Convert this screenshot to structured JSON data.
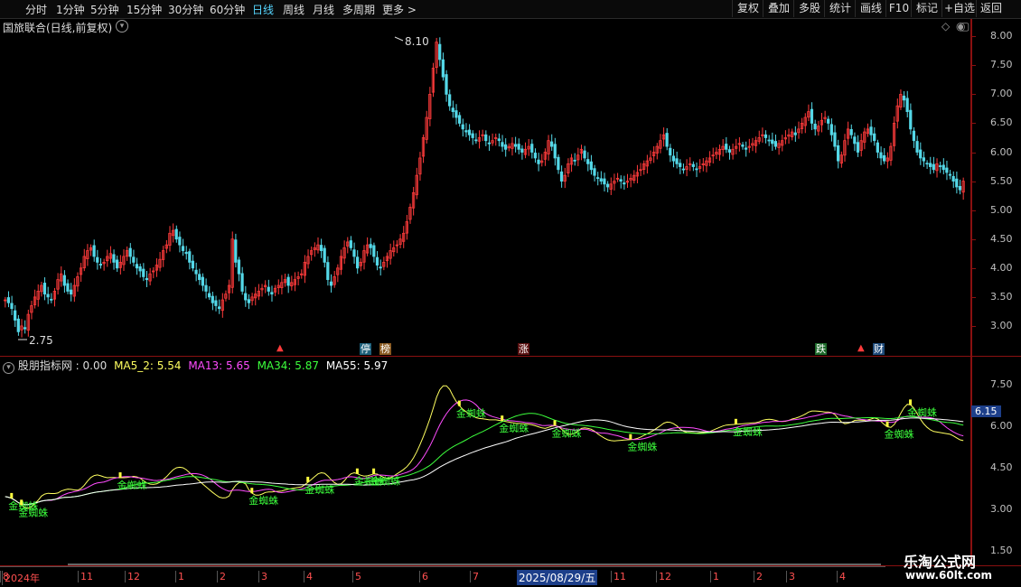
{
  "toolbar": {
    "periods": [
      "分时",
      "1分钟",
      "5分钟",
      "15分钟",
      "30分钟",
      "60分钟",
      "日线",
      "周线",
      "月线",
      "多周期",
      "更多 >"
    ],
    "active": "日线",
    "right": [
      "复权",
      "叠加",
      "多股",
      "统计",
      "画线",
      "F10",
      "标记",
      "+自选",
      "返回"
    ]
  },
  "main_chart": {
    "title": "国旅联合(日线,前复权)",
    "high_label": "8.10",
    "low_label": "2.75",
    "y_ticks": [
      "8.00",
      "7.50",
      "7.00",
      "6.50",
      "6.00",
      "5.50",
      "5.00",
      "4.50",
      "4.00",
      "3.50",
      "3.00"
    ],
    "badges": [
      "停",
      "榜",
      "涨",
      "跌",
      "财"
    ]
  },
  "indicator": {
    "name": "股朋指标网",
    "value": ": 0.00",
    "ma5": "MA5_2: 5.54",
    "ma13": "MA13: 5.65",
    "ma34": "MA34: 5.87",
    "ma55": "MA55: 5.97",
    "y_ticks": [
      "7.50",
      "6.00",
      "4.50",
      "3.00",
      "1.50"
    ],
    "current_price": "6.15",
    "signal_label": "金蜘蛛"
  },
  "time_axis": [
    "2024年",
    "11",
    "12",
    "1",
    "2",
    "3",
    "4",
    "5",
    "6",
    "7",
    "8",
    "2025/08/29/五",
    "11",
    "12",
    "1",
    "2",
    "3",
    "4"
  ],
  "watermark": {
    "line1": "乐淘公式网",
    "line2": "www.60lt.com"
  },
  "colors": {
    "up": "#ff3b3b",
    "down": "#54d8e8",
    "ma5": "#ffff60",
    "ma13": "#ff4cff",
    "ma34": "#3cff3c",
    "ma55": "#ffffff",
    "frame": "#8a1010"
  },
  "chart_data": {
    "type": "candlestick",
    "ylim": [
      2.5,
      8.3
    ],
    "closes": [
      3.45,
      3.4,
      3.3,
      3.1,
      2.9,
      3.0,
      2.95,
      3.2,
      3.35,
      3.5,
      3.6,
      3.7,
      3.55,
      3.5,
      3.45,
      3.6,
      3.8,
      3.9,
      3.7,
      3.6,
      3.55,
      3.7,
      3.85,
      4.0,
      4.2,
      4.3,
      4.35,
      4.2,
      4.1,
      4.05,
      4.1,
      4.2,
      4.25,
      4.1,
      4.0,
      4.1,
      4.2,
      4.3,
      4.2,
      4.1,
      4.0,
      3.95,
      3.85,
      3.8,
      3.9,
      3.95,
      4.05,
      4.15,
      4.3,
      4.4,
      4.6,
      4.65,
      4.5,
      4.4,
      4.3,
      4.25,
      4.1,
      4.0,
      3.9,
      3.8,
      3.7,
      3.6,
      3.5,
      3.4,
      3.35,
      3.3,
      3.45,
      3.55,
      3.7,
      4.5,
      4.1,
      3.9,
      3.6,
      3.45,
      3.4,
      3.5,
      3.55,
      3.6,
      3.65,
      3.7,
      3.6,
      3.55,
      3.65,
      3.7,
      3.75,
      3.8,
      3.7,
      3.75,
      3.8,
      3.85,
      3.9,
      4.1,
      4.2,
      4.3,
      4.35,
      4.4,
      4.3,
      4.1,
      3.8,
      3.7,
      3.85,
      4.0,
      4.2,
      4.35,
      4.45,
      4.35,
      4.2,
      4.0,
      4.1,
      4.3,
      4.4,
      4.35,
      4.2,
      4.05,
      4.0,
      4.1,
      4.2,
      4.3,
      4.35,
      4.4,
      4.5,
      4.6,
      4.8,
      5.05,
      5.3,
      5.6,
      5.9,
      6.25,
      6.6,
      7.0,
      7.45,
      7.9,
      7.6,
      7.3,
      7.0,
      6.8,
      6.7,
      6.6,
      6.5,
      6.4,
      6.35,
      6.3,
      6.25,
      6.2,
      6.25,
      6.3,
      6.2,
      6.15,
      6.2,
      6.25,
      6.2,
      6.1,
      6.05,
      6.1,
      6.15,
      6.1,
      6.05,
      6.0,
      6.05,
      6.1,
      6.0,
      5.9,
      5.8,
      5.85,
      6.0,
      6.2,
      6.1,
      5.9,
      5.7,
      5.5,
      5.6,
      5.8,
      5.9,
      5.85,
      5.95,
      6.05,
      5.9,
      5.8,
      5.7,
      5.6,
      5.55,
      5.5,
      5.45,
      5.4,
      5.45,
      5.5,
      5.55,
      5.5,
      5.45,
      5.5,
      5.55,
      5.6,
      5.65,
      5.7,
      5.8,
      5.85,
      5.9,
      6.0,
      6.1,
      6.2,
      6.3,
      6.1,
      5.95,
      5.85,
      5.8,
      5.75,
      5.7,
      5.75,
      5.8,
      5.75,
      5.7,
      5.75,
      5.8,
      5.85,
      5.9,
      5.95,
      6.0,
      6.05,
      6.1,
      6.05,
      6.0,
      6.05,
      6.1,
      6.15,
      6.1,
      6.05,
      6.1,
      6.15,
      6.2,
      6.25,
      6.3,
      6.25,
      6.2,
      6.15,
      6.1,
      6.15,
      6.2,
      6.25,
      6.3,
      6.35,
      6.3,
      6.4,
      6.5,
      6.6,
      6.7,
      6.5,
      6.4,
      6.45,
      6.55,
      6.6,
      6.5,
      6.3,
      6.1,
      5.85,
      5.95,
      6.2,
      6.4,
      6.3,
      6.15,
      6.0,
      6.2,
      6.35,
      6.4,
      6.3,
      6.2,
      6.0,
      5.9,
      5.85,
      5.9,
      6.1,
      6.5,
      6.8,
      7.0,
      6.9,
      6.7,
      6.4,
      6.2,
      6.0,
      5.9,
      5.85,
      5.8,
      5.75,
      5.7,
      5.8,
      5.75,
      5.7,
      5.65,
      5.6,
      5.5,
      5.4,
      5.35,
      5.5
    ]
  }
}
